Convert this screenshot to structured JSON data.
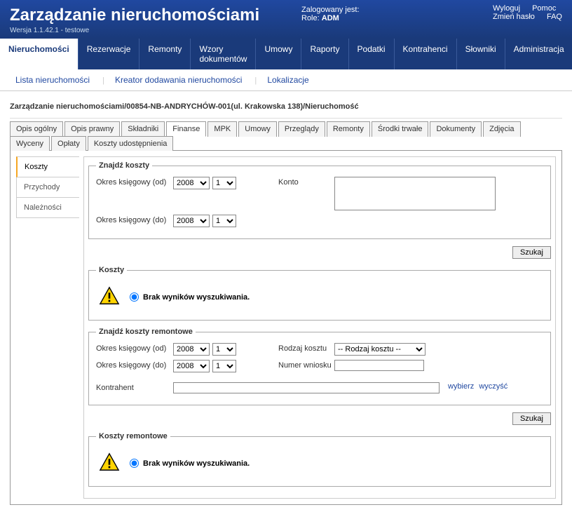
{
  "header": {
    "title": "Zarządzanie nieruchomościami",
    "version": "Wersja 1.1.42.1 - testowe",
    "logged_label": "Zalogowany jest:",
    "role_label": "Role:",
    "role_value": "ADM",
    "links": {
      "logout": "Wyloguj",
      "change_pw": "Zmień hasło",
      "help": "Pomoc",
      "faq": "FAQ"
    }
  },
  "main_nav": [
    "Nieruchomości",
    "Rezerwacje",
    "Remonty",
    "Wzory dokumentów",
    "Umowy",
    "Raporty",
    "Podatki",
    "Kontrahenci",
    "Słowniki",
    "Administracja"
  ],
  "sub_nav": [
    "Lista nieruchomości",
    "Kreator dodawania nieruchomości",
    "Lokalizacje"
  ],
  "breadcrumb": "Zarządzanie nieruchomościami/00854-NB-ANDRYCHÓW-001(ul. Krakowska 138)/Nieruchomość",
  "inner_tabs": [
    "Opis ogólny",
    "Opis prawny",
    "Składniki",
    "Finanse",
    "MPK",
    "Umowy",
    "Przeglądy",
    "Remonty",
    "Środki trwałe",
    "Dokumenty",
    "Zdjęcia",
    "Wyceny",
    "Opłaty",
    "Koszty udostępnienia"
  ],
  "inner_tabs_active": 3,
  "side_tabs": [
    "Koszty",
    "Przychody",
    "Należności"
  ],
  "side_tabs_active": 0,
  "find_costs": {
    "legend": "Znajdź koszty",
    "period_from": "Okres księgowy (od)",
    "period_to": "Okres księgowy (do)",
    "year_from": "2008",
    "month_from": "1",
    "year_to": "2008",
    "month_to": "1",
    "account_label": "Konto",
    "account_value": ""
  },
  "buttons": {
    "search": "Szukaj"
  },
  "costs_result": {
    "legend": "Koszty",
    "message": "Brak wyników wyszukiwania."
  },
  "find_renov": {
    "legend": "Znajdź koszty remontowe",
    "period_from": "Okres księgowy (od)",
    "period_to": "Okres księgowy (do)",
    "year_from": "2008",
    "month_from": "1",
    "year_to": "2008",
    "month_to": "1",
    "kind_label": "Rodzaj kosztu",
    "kind_value": "-- Rodzaj kosztu --",
    "req_label": "Numer wniosku",
    "req_value": "",
    "contractor_label": "Kontrahent",
    "contractor_value": "",
    "action_select": "wybierz",
    "action_clear": "wyczyść"
  },
  "renov_result": {
    "legend": "Koszty remontowe",
    "message": "Brak wyników wyszukiwania."
  }
}
